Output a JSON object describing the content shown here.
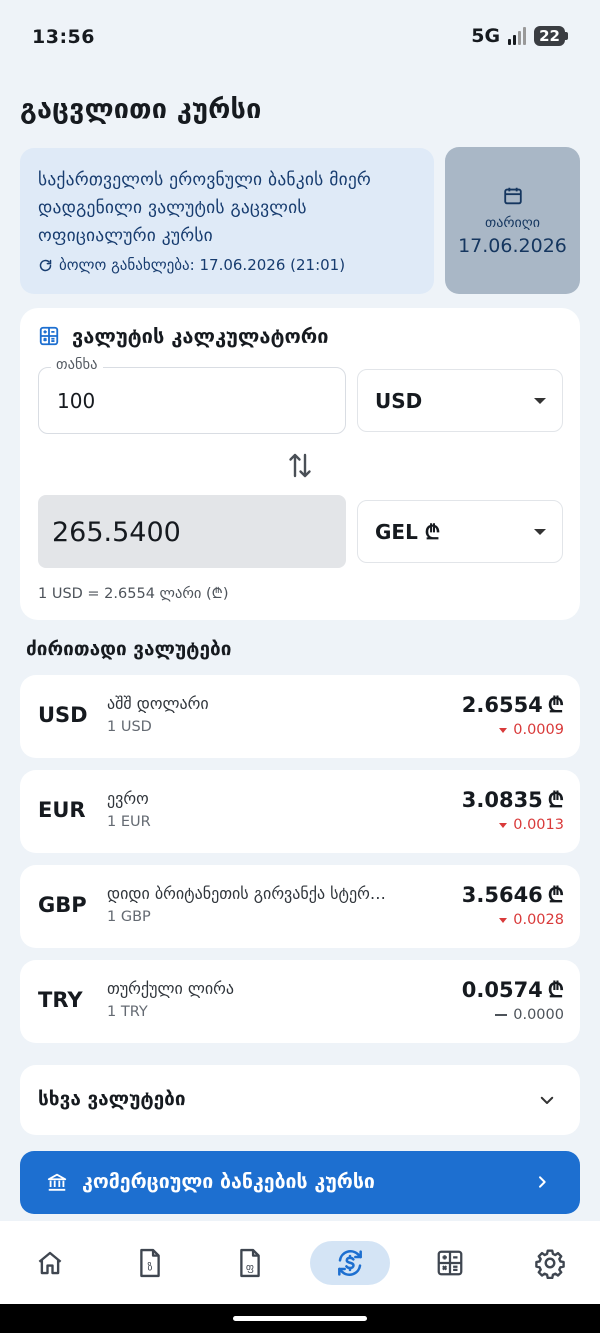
{
  "status_bar": {
    "time": "13:56",
    "network": "5G",
    "battery": "22"
  },
  "page": {
    "title": "გაცვლითი კურსი"
  },
  "info": {
    "description": "საქართველოს ეროვნული ბანკის მიერ დადგენილი ვალუტის გაცვლის ოფიციალური კურსი",
    "updated": "ბოლო განახლება: 17.06.2026 (21:01)"
  },
  "date_card": {
    "label": "თარიღი",
    "value": "17.06.2026"
  },
  "calculator": {
    "title": "ვალუტის კალკულატორი",
    "amount_label": "თანხა",
    "amount_value": "100",
    "from_currency": "USD",
    "to_currency": "GEL ₾",
    "result": "265.5400",
    "rate_note": "1 USD = 2.6554 ლარი (₾)"
  },
  "main_currencies": {
    "title": "ძირითადი ვალუტები",
    "items": [
      {
        "code": "USD",
        "name": "აშშ დოლარი",
        "unit": "1 USD",
        "rate": "2.6554",
        "change": "0.0009",
        "trend": "down"
      },
      {
        "code": "EUR",
        "name": "ევრო",
        "unit": "1 EUR",
        "rate": "3.0835",
        "change": "0.0013",
        "trend": "down"
      },
      {
        "code": "GBP",
        "name": "დიდი ბრიტანეთის გირვანქა სტერლინგი",
        "unit": "1 GBP",
        "rate": "3.5646",
        "change": "0.0028",
        "trend": "down"
      },
      {
        "code": "TRY",
        "name": "თურქული ლირა",
        "unit": "1 TRY",
        "rate": "0.0574",
        "change": "0.0000",
        "trend": "flat"
      }
    ],
    "currency_symbol": "₾"
  },
  "other_currencies": {
    "label": "სხვა ვალუტები"
  },
  "bank_button": {
    "label": "კომერციული ბანკების კურსი"
  },
  "nav": {
    "items": [
      {
        "icon": "home-icon",
        "active": false
      },
      {
        "icon": "document-icon",
        "active": false
      },
      {
        "icon": "document-alt-icon",
        "active": false
      },
      {
        "icon": "currency-exchange-icon",
        "active": true
      },
      {
        "icon": "calculator-icon",
        "active": false
      },
      {
        "icon": "settings-icon",
        "active": false
      }
    ]
  },
  "colors": {
    "background": "#eef3f8",
    "accent": "#1d6fd0",
    "info_bg": "#dfeaf7",
    "date_bg": "#a9b7c6",
    "negative": "#d93a3a"
  }
}
